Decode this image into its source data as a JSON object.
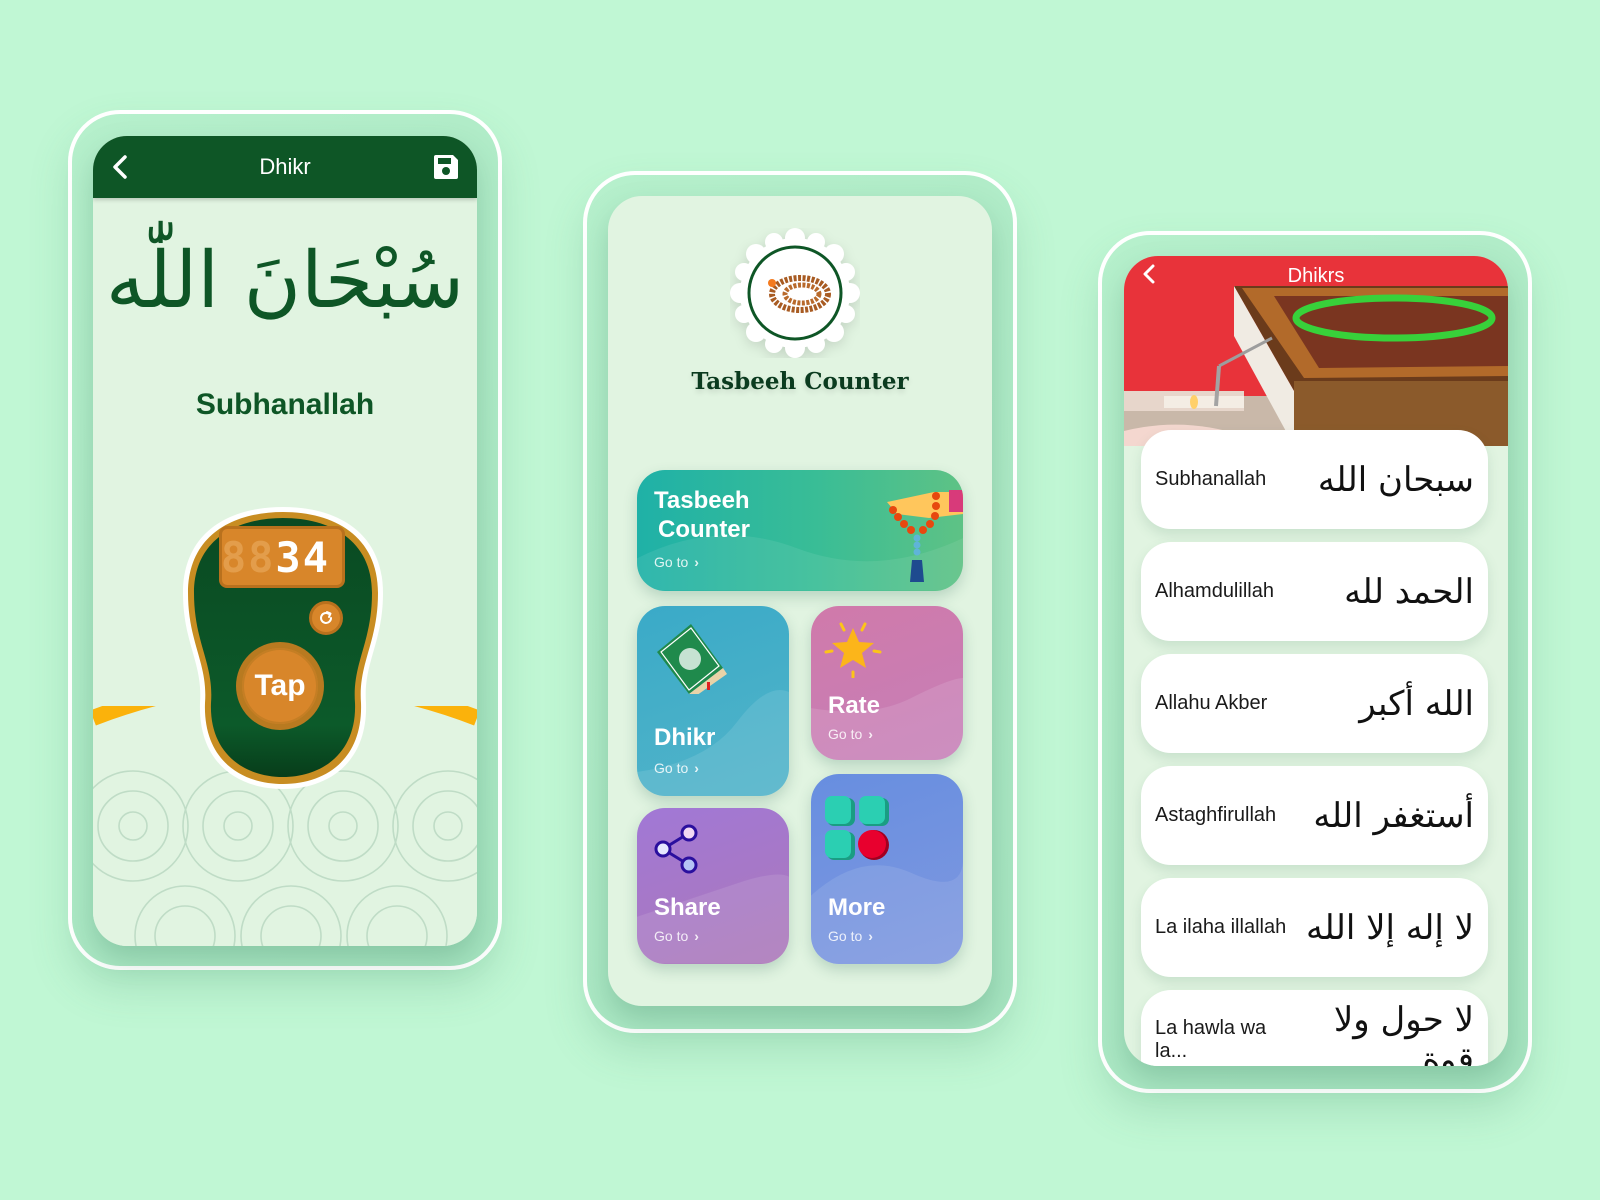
{
  "colors": {
    "background": "#c0f7d4",
    "primary_green": "#0e5626",
    "accent_orange": "#d8862a",
    "accent_yellow": "#fbb20b",
    "screen_bg": "#e1f4e1"
  },
  "counter_screen": {
    "appbar": {
      "title": "Dhikr",
      "back_icon": "chevron-left-icon",
      "save_icon": "floppy-disk-icon"
    },
    "calligraphy": "سُبْحَانَ اللّٰه",
    "dhikr_name": "Subhanallah",
    "counter": {
      "ghost_digits": "88",
      "value": "34",
      "reset_icon": "refresh-icon",
      "tap_label": "Tap"
    }
  },
  "home_screen": {
    "logo_icon": "prayer-beads-icon",
    "app_title": "Tasbeeh Counter",
    "tiles": [
      {
        "id": "tasbeeh",
        "label_line1": "Tasbeeh",
        "label_line2": "Counter",
        "go": "Go to",
        "icon": "hand-with-beads-icon"
      },
      {
        "id": "dhikr",
        "label": "Dhikr",
        "go": "Go to",
        "icon": "quran-book-icon"
      },
      {
        "id": "rate",
        "label": "Rate",
        "go": "Go to",
        "icon": "star-icon"
      },
      {
        "id": "share",
        "label": "Share",
        "go": "Go to",
        "icon": "share-icon"
      },
      {
        "id": "more",
        "label": "More",
        "go": "Go to",
        "icon": "apps-grid-icon"
      }
    ]
  },
  "list_screen": {
    "appbar": {
      "title": "Dhikrs",
      "back_icon": "chevron-left-icon"
    },
    "items": [
      {
        "name": "Subhanallah",
        "arabic": "سبحان الله"
      },
      {
        "name": "Alhamdulillah",
        "arabic": "الحمد لله"
      },
      {
        "name": "Allahu Akber",
        "arabic": "الله أكبر"
      },
      {
        "name": "Astaghfirullah",
        "arabic": "أستغفر الله"
      },
      {
        "name": "La ilaha illallah",
        "arabic": "لا إله إلا الله"
      },
      {
        "name": "La hawla wa la...",
        "arabic": "لا حول ولا قوة"
      }
    ]
  }
}
